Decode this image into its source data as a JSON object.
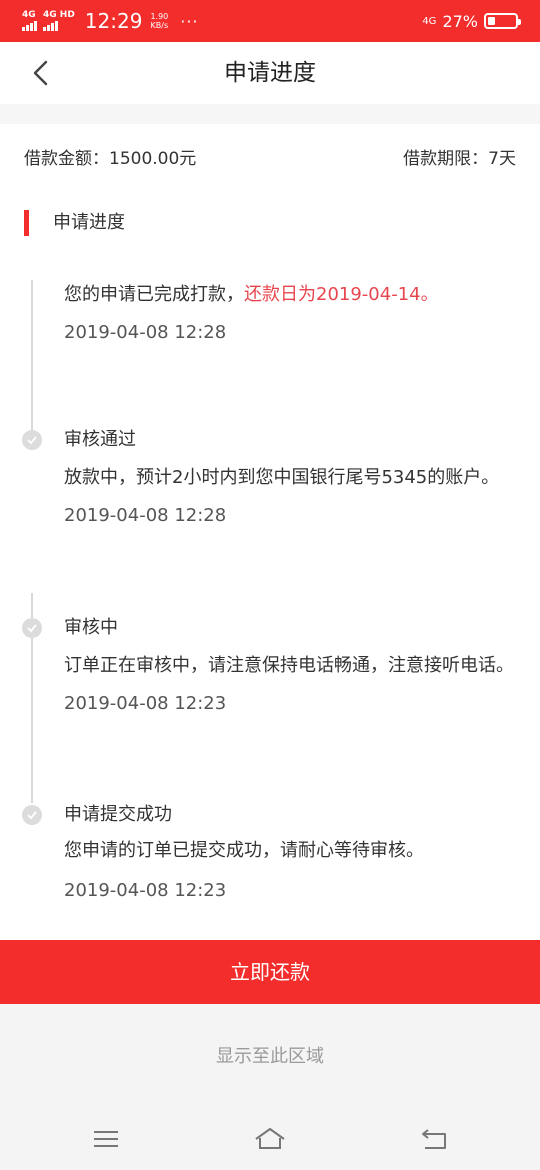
{
  "status_bar": {
    "signal1": "4G",
    "signal2": "4G HD",
    "time": "12:29",
    "speed_value": "1.90",
    "speed_unit": "KB/s",
    "dots": "···",
    "net": "4G",
    "battery_pct": "27%",
    "battery_level": 0.27
  },
  "nav": {
    "title": "申请进度",
    "back_icon": "chevron-left-icon"
  },
  "loan": {
    "amount": "借款金额：1500.00元",
    "term": "借款期限：7天"
  },
  "section": {
    "title": "申请进度"
  },
  "timeline": [
    {
      "status": "",
      "text_prefix": "您的申请已完成打款，",
      "text_highlight": "还款日为2019-04-14。",
      "time": "2019-04-08 12:28"
    },
    {
      "status": "审核通过",
      "text": "放款中，预计2小时内到您中国银行尾号5345的账户。",
      "time": "2019-04-08 12:28"
    },
    {
      "status": "审核中",
      "text": "订单正在审核中，请注意保持电话畅通，注意接听电话。",
      "time": "2019-04-08 12:23"
    },
    {
      "status": "申请提交成功",
      "text": "您申请的订单已提交成功，请耐心等待审核。",
      "time": "2019-04-08 12:23"
    }
  ],
  "actions": {
    "repay_label": "立即还款"
  },
  "bottom": {
    "region_text": "显示至此区域"
  },
  "colors": {
    "accent": "#f22d2c",
    "highlight_text": "#e8464f"
  },
  "nav_keys": [
    "menu-icon",
    "home-icon",
    "back-icon"
  ]
}
